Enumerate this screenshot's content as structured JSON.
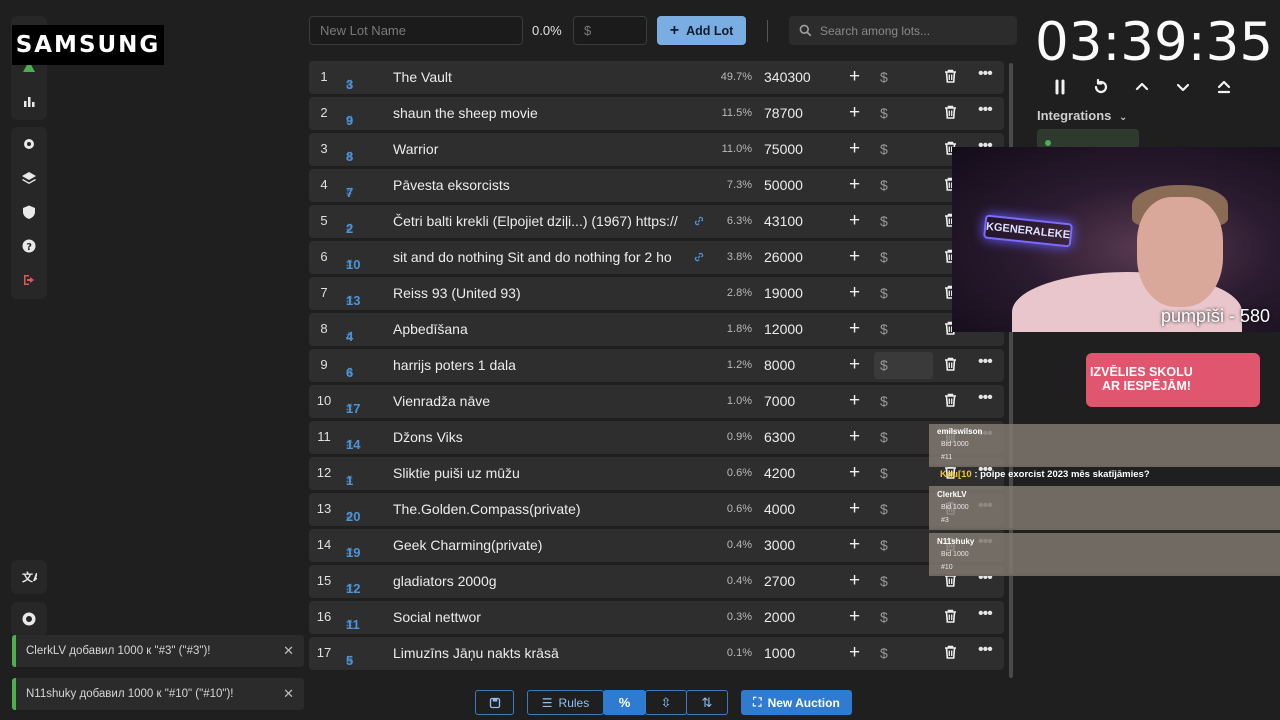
{
  "overlay": {
    "brand": "SAMSUNG",
    "cam_caption": "pumpīši - 580",
    "neon_sign": "KGENERALEKE",
    "banner": [
      "IZVĒLIES SKOLU",
      "AR IESPĒJĀM!"
    ]
  },
  "toolbar": {
    "lot_name_placeholder": "New Lot Name",
    "percent": "0.0%",
    "amount_placeholder": "$",
    "add_label": "Add Lot",
    "search_placeholder": "Search among lots..."
  },
  "timer": {
    "value": "03:39:35",
    "integrations_label": "Integrations"
  },
  "lots": [
    {
      "idx": "1",
      "id": "3",
      "name": "The Vault",
      "pct": "49.7%",
      "amount": "340300",
      "link": false
    },
    {
      "idx": "2",
      "id": "9",
      "name": "shaun the sheep movie",
      "pct": "11.5%",
      "amount": "78700",
      "link": false
    },
    {
      "idx": "3",
      "id": "8",
      "name": "Warrior",
      "pct": "11.0%",
      "amount": "75000",
      "link": false
    },
    {
      "idx": "4",
      "id": "7",
      "name": "Pāvesta eksorcists",
      "pct": "7.3%",
      "amount": "50000",
      "link": false
    },
    {
      "idx": "5",
      "id": "2",
      "name": "Četri balti krekli (Elpojiet dziļi...) (1967) https://",
      "pct": "6.3%",
      "amount": "43100",
      "link": true
    },
    {
      "idx": "6",
      "id": "10",
      "name": "sit and do nothing Sit and do nothing for 2 ho",
      "pct": "3.8%",
      "amount": "26000",
      "link": true
    },
    {
      "idx": "7",
      "id": "13",
      "name": "Reiss 93 (United 93)",
      "pct": "2.8%",
      "amount": "19000",
      "link": false
    },
    {
      "idx": "8",
      "id": "4",
      "name": "Apbedīšana",
      "pct": "1.8%",
      "amount": "12000",
      "link": false
    },
    {
      "idx": "9",
      "id": "6",
      "name": "harrijs poters 1 dala",
      "pct": "1.2%",
      "amount": "8000",
      "link": false
    },
    {
      "idx": "10",
      "id": "17",
      "name": "Vienradža nāve",
      "pct": "1.0%",
      "amount": "7000",
      "link": false
    },
    {
      "idx": "11",
      "id": "14",
      "name": "Džons Viks",
      "pct": "0.9%",
      "amount": "6300",
      "link": false
    },
    {
      "idx": "12",
      "id": "1",
      "name": "Sliktie puiši uz mūžu",
      "pct": "0.6%",
      "amount": "4200",
      "link": false
    },
    {
      "idx": "13",
      "id": "20",
      "name": "The.Golden.Compass(private)",
      "pct": "0.6%",
      "amount": "4000",
      "link": false
    },
    {
      "idx": "14",
      "id": "19",
      "name": "Geek Charming(private)",
      "pct": "0.4%",
      "amount": "3000",
      "link": false
    },
    {
      "idx": "15",
      "id": "12",
      "name": "gladiators 2000g",
      "pct": "0.4%",
      "amount": "2700",
      "link": false
    },
    {
      "idx": "16",
      "id": "11",
      "name": "Social nettwor",
      "pct": "0.3%",
      "amount": "2000",
      "link": false
    },
    {
      "idx": "17",
      "id": "5",
      "name": "Limuzīns Jāņu nakts krāsā",
      "pct": "0.1%",
      "amount": "1000",
      "link": false
    }
  ],
  "bottom": {
    "rules_label": "Rules",
    "new_auction_label": "New Auction"
  },
  "toasts": [
    "ClerkLV добавил 1000 к \"#3\" (\"#3\")!",
    "N11shuky добавил 1000 к \"#10\" (\"#10\")!"
  ],
  "chat": {
    "cards": [
      {
        "user": "emilswilson",
        "text": "Bid 1000",
        "tag": "#11"
      },
      {
        "user": "ClerkLV",
        "text": "Bid 1000",
        "tag": "#3"
      },
      {
        "user": "N11shuky",
        "text": "Bid 1000",
        "tag": "#10"
      }
    ],
    "message_user": "Kau[10",
    "message_text": ": poipe exorcist 2023 mēs skatījāmies?"
  },
  "colors": {
    "accent": "#7aaee3",
    "id_blue": "#4f93d6",
    "toast_green": "#4caf50"
  }
}
